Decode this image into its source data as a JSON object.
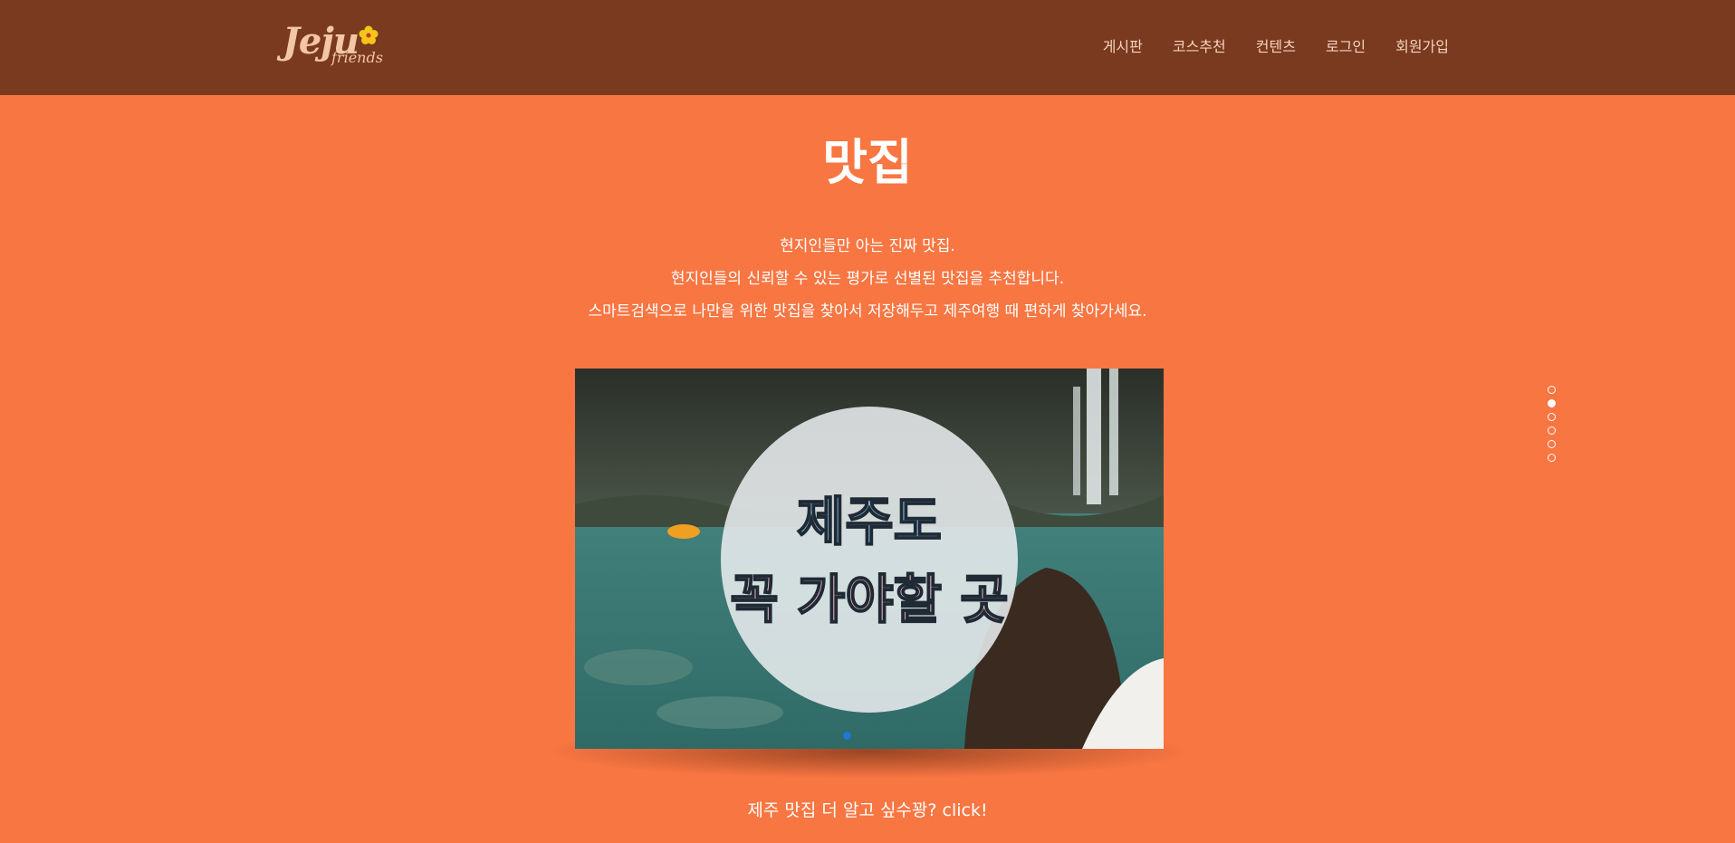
{
  "header": {
    "logo": {
      "main": "Jeju",
      "sub": "friends"
    },
    "nav": [
      "게시판",
      "코스추천",
      "컨텐츠",
      "로그인",
      "회원가입"
    ]
  },
  "section": {
    "title": "맛집",
    "description": [
      "현지인들만 아는 진짜 맛집.",
      "현지인들의 신뢰할 수 있는 평가로 선별된 맛집을 추천합니다.",
      "스마트검색으로 나만을 위한 맛집을 찾아서 저장해두고 제주여행 때 편하게 찾아가세요."
    ],
    "slide": {
      "line1": "제주도",
      "line2": "꼭 가야할 곳"
    },
    "cta": "제주 맛집 더 알고 싶수꽝? click!"
  },
  "side_nav": {
    "count": 6,
    "active_index": 1
  },
  "colors": {
    "background": "#f87642",
    "header": "#7a3a20",
    "nav_text": "#f6d3bc"
  }
}
